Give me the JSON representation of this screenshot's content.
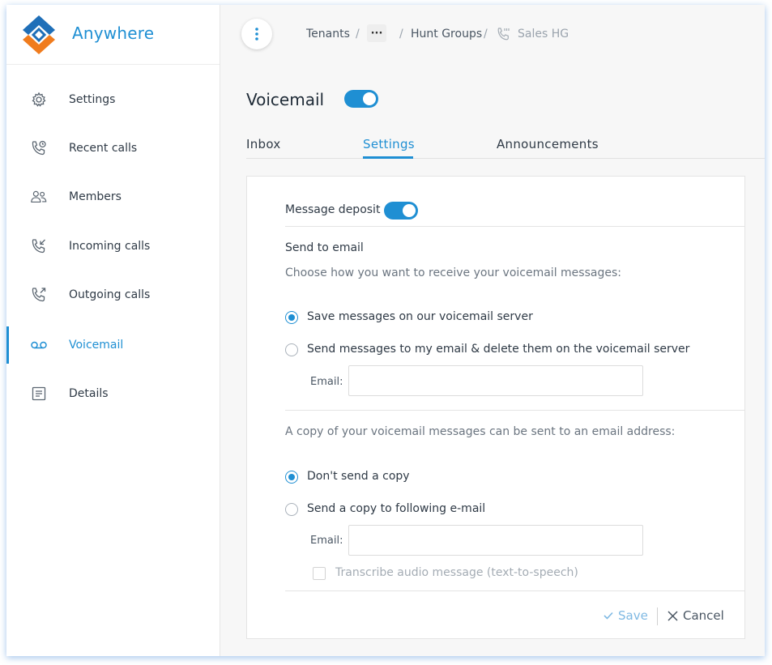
{
  "brand": {
    "name": "Anywhere"
  },
  "sidebar": {
    "items": [
      {
        "label": "Settings",
        "icon": "gear-icon"
      },
      {
        "label": "Recent calls",
        "icon": "phone-clock-icon"
      },
      {
        "label": "Members",
        "icon": "members-icon"
      },
      {
        "label": "Incoming calls",
        "icon": "phone-incoming-icon"
      },
      {
        "label": "Outgoing calls",
        "icon": "phone-outgoing-icon"
      },
      {
        "label": "Voicemail",
        "icon": "voicemail-icon",
        "active": true
      },
      {
        "label": "Details",
        "icon": "document-icon"
      }
    ]
  },
  "breadcrumb": {
    "items": [
      "Tenants",
      "Hunt Groups",
      "Sales HG"
    ],
    "ellipsis": "···",
    "separator": "/"
  },
  "page": {
    "title": "Voicemail",
    "enabled": true
  },
  "tabs": [
    {
      "label": "Inbox"
    },
    {
      "label": "Settings",
      "active": true
    },
    {
      "label": "Announcements"
    }
  ],
  "settings": {
    "message_deposit_label": "Message deposit",
    "message_deposit_on": true,
    "send_to_email_title": "Send to email",
    "receive_hint": "Choose how you want to receive your voicemail messages:",
    "receive_options": [
      {
        "label": "Save messages on our voicemail server",
        "selected": true
      },
      {
        "label": "Send messages to my email & delete them on the voicemail server",
        "selected": false
      }
    ],
    "email_label": "Email:",
    "email_value": "",
    "copy_hint": "A copy of your voicemail messages can be sent to an email address:",
    "copy_options": [
      {
        "label": "Don't send a copy",
        "selected": true
      },
      {
        "label": "Send a copy to following e-mail",
        "selected": false
      }
    ],
    "copy_email_label": "Email:",
    "copy_email_value": "",
    "transcribe_label": "Transcribe audio message (text-to-speech)",
    "transcribe_checked": false
  },
  "footer": {
    "save_label": "Save",
    "cancel_label": "Cancel"
  },
  "colors": {
    "accent": "#1f8fd3",
    "logo_orange": "#f07c1e",
    "logo_blue": "#1f6fb8"
  }
}
